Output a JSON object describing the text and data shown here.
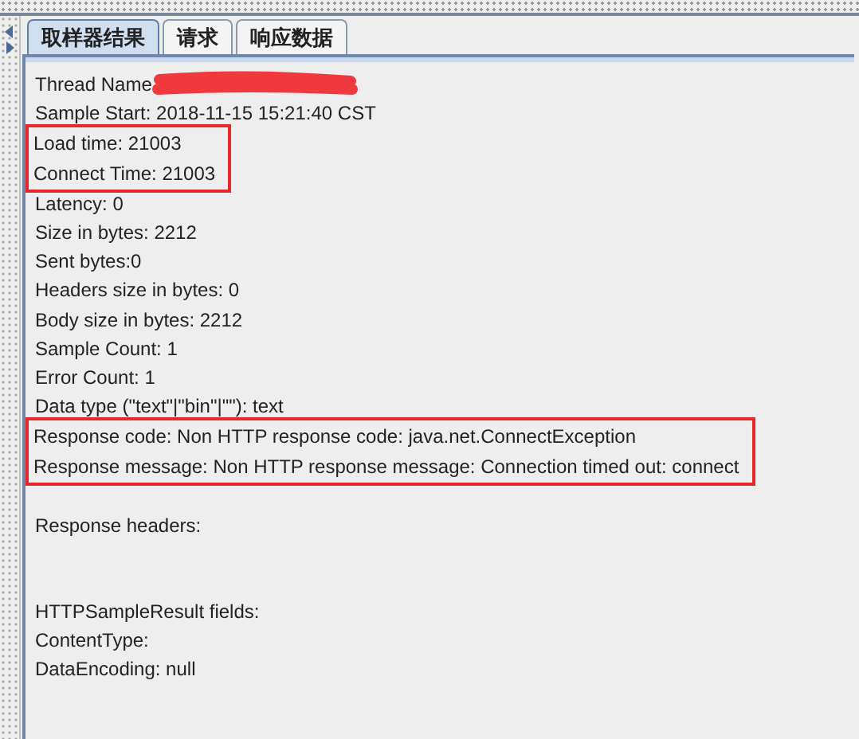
{
  "tabs": [
    {
      "label": "取样器结果",
      "selected": true
    },
    {
      "label": "请求",
      "selected": false
    },
    {
      "label": "响应数据",
      "selected": false
    }
  ],
  "groups": [
    {
      "highlighted": false,
      "lines": [
        {
          "text": "Thread Name",
          "redacted": true
        },
        {
          "text": "Sample Start: 2018-11-15 15:21:40 CST",
          "redacted": false
        }
      ]
    },
    {
      "highlighted": true,
      "lines": [
        {
          "text": "Load time: 21003",
          "redacted": false
        },
        {
          "text": "Connect Time: 21003",
          "redacted": false
        }
      ]
    },
    {
      "highlighted": false,
      "lines": [
        {
          "text": "Latency: 0",
          "redacted": false
        },
        {
          "text": "Size in bytes: 2212",
          "redacted": false
        },
        {
          "text": "Sent bytes:0",
          "redacted": false
        },
        {
          "text": "Headers size in bytes: 0",
          "redacted": false
        },
        {
          "text": "Body size in bytes: 2212",
          "redacted": false
        },
        {
          "text": "Sample Count: 1",
          "redacted": false
        },
        {
          "text": "Error Count: 1",
          "redacted": false
        },
        {
          "text": "Data type (\"text\"|\"bin\"|\"\"): text",
          "redacted": false
        }
      ]
    },
    {
      "highlighted": true,
      "lines": [
        {
          "text": "Response code: Non HTTP response code: java.net.ConnectException",
          "redacted": false
        },
        {
          "text": "Response message: Non HTTP response message: Connection timed out: connect",
          "redacted": false
        }
      ]
    },
    {
      "highlighted": false,
      "lines": [
        {
          "text": "Response headers:",
          "redacted": false
        }
      ]
    },
    {
      "highlighted": false,
      "lines": [
        {
          "text": "HTTPSampleResult fields:",
          "redacted": false
        },
        {
          "text": "ContentType:",
          "redacted": false
        },
        {
          "text": "DataEncoding: null",
          "redacted": false
        }
      ]
    }
  ]
}
